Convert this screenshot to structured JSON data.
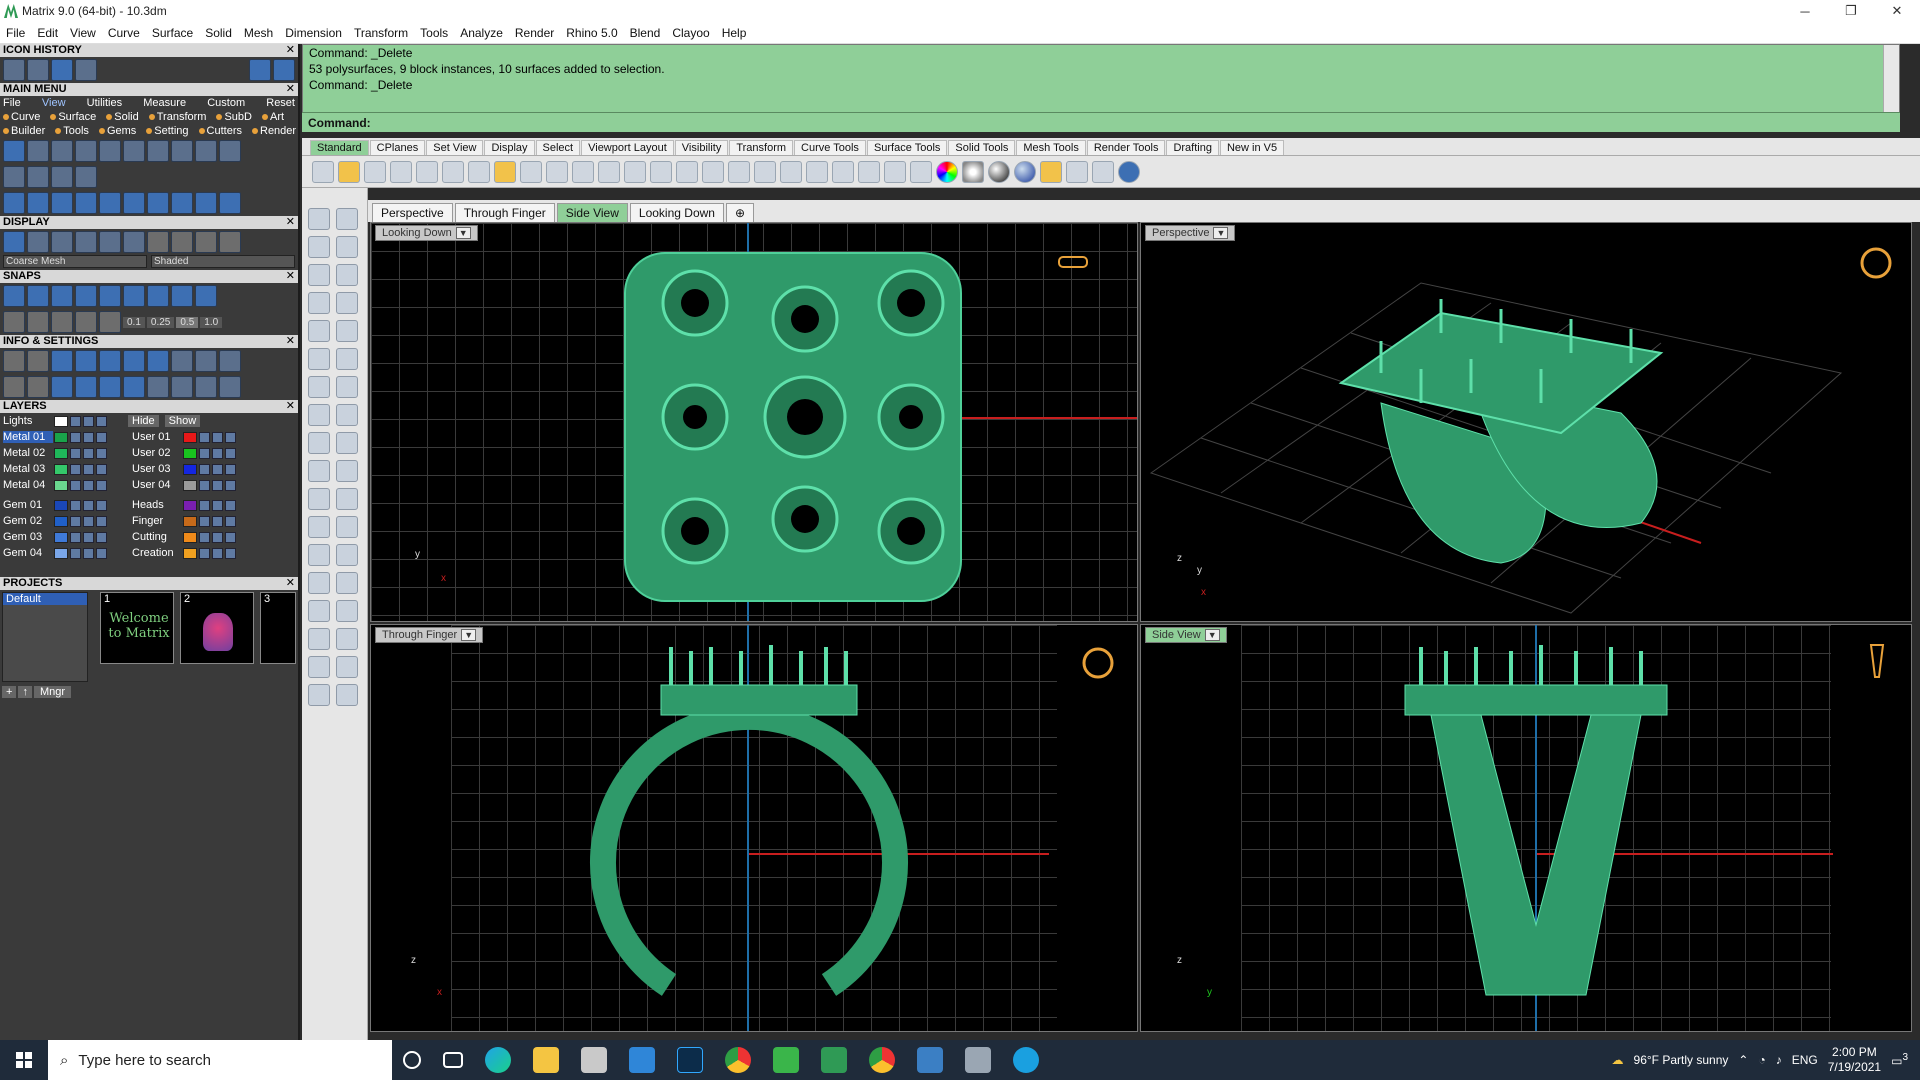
{
  "window": {
    "title": "Matrix 9.0 (64-bit) - 10.3dm",
    "minimize": "─",
    "maximize": "❐",
    "close": "✕"
  },
  "menubar": [
    "File",
    "Edit",
    "View",
    "Curve",
    "Surface",
    "Solid",
    "Mesh",
    "Dimension",
    "Transform",
    "Tools",
    "Analyze",
    "Render",
    "Rhino 5.0",
    "Blend",
    "Clayoo",
    "Help"
  ],
  "left": {
    "icon_history": "ICON HISTORY",
    "main_menu": "MAIN MENU",
    "main_menu_tabs": [
      "File",
      "View",
      "Utilities",
      "Measure",
      "Custom",
      "Reset"
    ],
    "main_menu_row2": [
      "Curve",
      "Surface",
      "Solid",
      "Transform",
      "SubD",
      "Art"
    ],
    "main_menu_row3": [
      "Builder",
      "Tools",
      "Gems",
      "Setting",
      "Cutters",
      "Render"
    ],
    "display": "DISPLAY",
    "display_left": "Coarse Mesh",
    "display_right": "Shaded",
    "snaps": "SNAPS",
    "snap_values": [
      "0.1",
      "0.25",
      "0.5",
      "1.0"
    ],
    "info_settings": "INFO & SETTINGS",
    "layers": "LAYERS",
    "lights": "Lights",
    "hide": "Hide",
    "show": "Show",
    "layers_left": [
      "Metal 01",
      "Metal 02",
      "Metal 03",
      "Metal 04",
      "Gem 01",
      "Gem 02",
      "Gem 03",
      "Gem 04"
    ],
    "layers_right": [
      "User 01",
      "User 02",
      "User 03",
      "User 04",
      "Heads",
      "Finger",
      "Cutting",
      "Creation"
    ],
    "layers_right_colors": [
      "#e81818",
      "#19c41f",
      "#1426e0",
      "#9a9a9a",
      "#7a1fb0",
      "#c76a1a",
      "#f08a1a",
      "#f0a020"
    ],
    "layers_left_colors": [
      "#19a34a",
      "#1fb85a",
      "#34c86a",
      "#6ad88e",
      "#1a47b8",
      "#2060c8",
      "#3f7ad8",
      "#7aa6e8"
    ],
    "projects": "PROJECTS",
    "project_default": "Default",
    "project_numbers": [
      "1",
      "2",
      "3"
    ],
    "project_thumb1": "Welcome to Matrix",
    "project_mngr": "Mngr"
  },
  "command": {
    "lines": [
      "Command: _Delete",
      "53 polysurfaces, 9 block instances, 10 surfaces added to selection.",
      "Command: _Delete"
    ],
    "prompt": "Command:"
  },
  "toolbar_tabs": [
    "Standard",
    "CPlanes",
    "Set View",
    "Display",
    "Select",
    "Viewport Layout",
    "Visibility",
    "Transform",
    "Curve Tools",
    "Surface Tools",
    "Solid Tools",
    "Mesh Tools",
    "Render Tools",
    "Drafting",
    "New in V5"
  ],
  "viewport_tabs": [
    "Perspective",
    "Through Finger",
    "Side View",
    "Looking Down"
  ],
  "viewports": {
    "top_left": {
      "label": "Looking Down",
      "axis_a": "y",
      "axis_b": "x"
    },
    "top_right": {
      "label": "Perspective",
      "axis_a": "z",
      "axis_b": "y",
      "axis_c": "x"
    },
    "bottom_left": {
      "label": "Through Finger",
      "axis_a": "z",
      "axis_b": "x"
    },
    "bottom_right": {
      "label": "Side View",
      "axis_a": "z",
      "axis_b": "y"
    }
  },
  "taskbar": {
    "search_placeholder": "Type here to search",
    "weather": "96°F  Partly sunny",
    "lang": "ENG",
    "time": "2:00 PM",
    "date": "7/19/2021",
    "notif_count": "3"
  },
  "colors": {
    "model": "#2f9a6a",
    "panel_green": "#8fcf98",
    "axis_red": "#c81e1e",
    "axis_blue": "#1e6ea8"
  }
}
